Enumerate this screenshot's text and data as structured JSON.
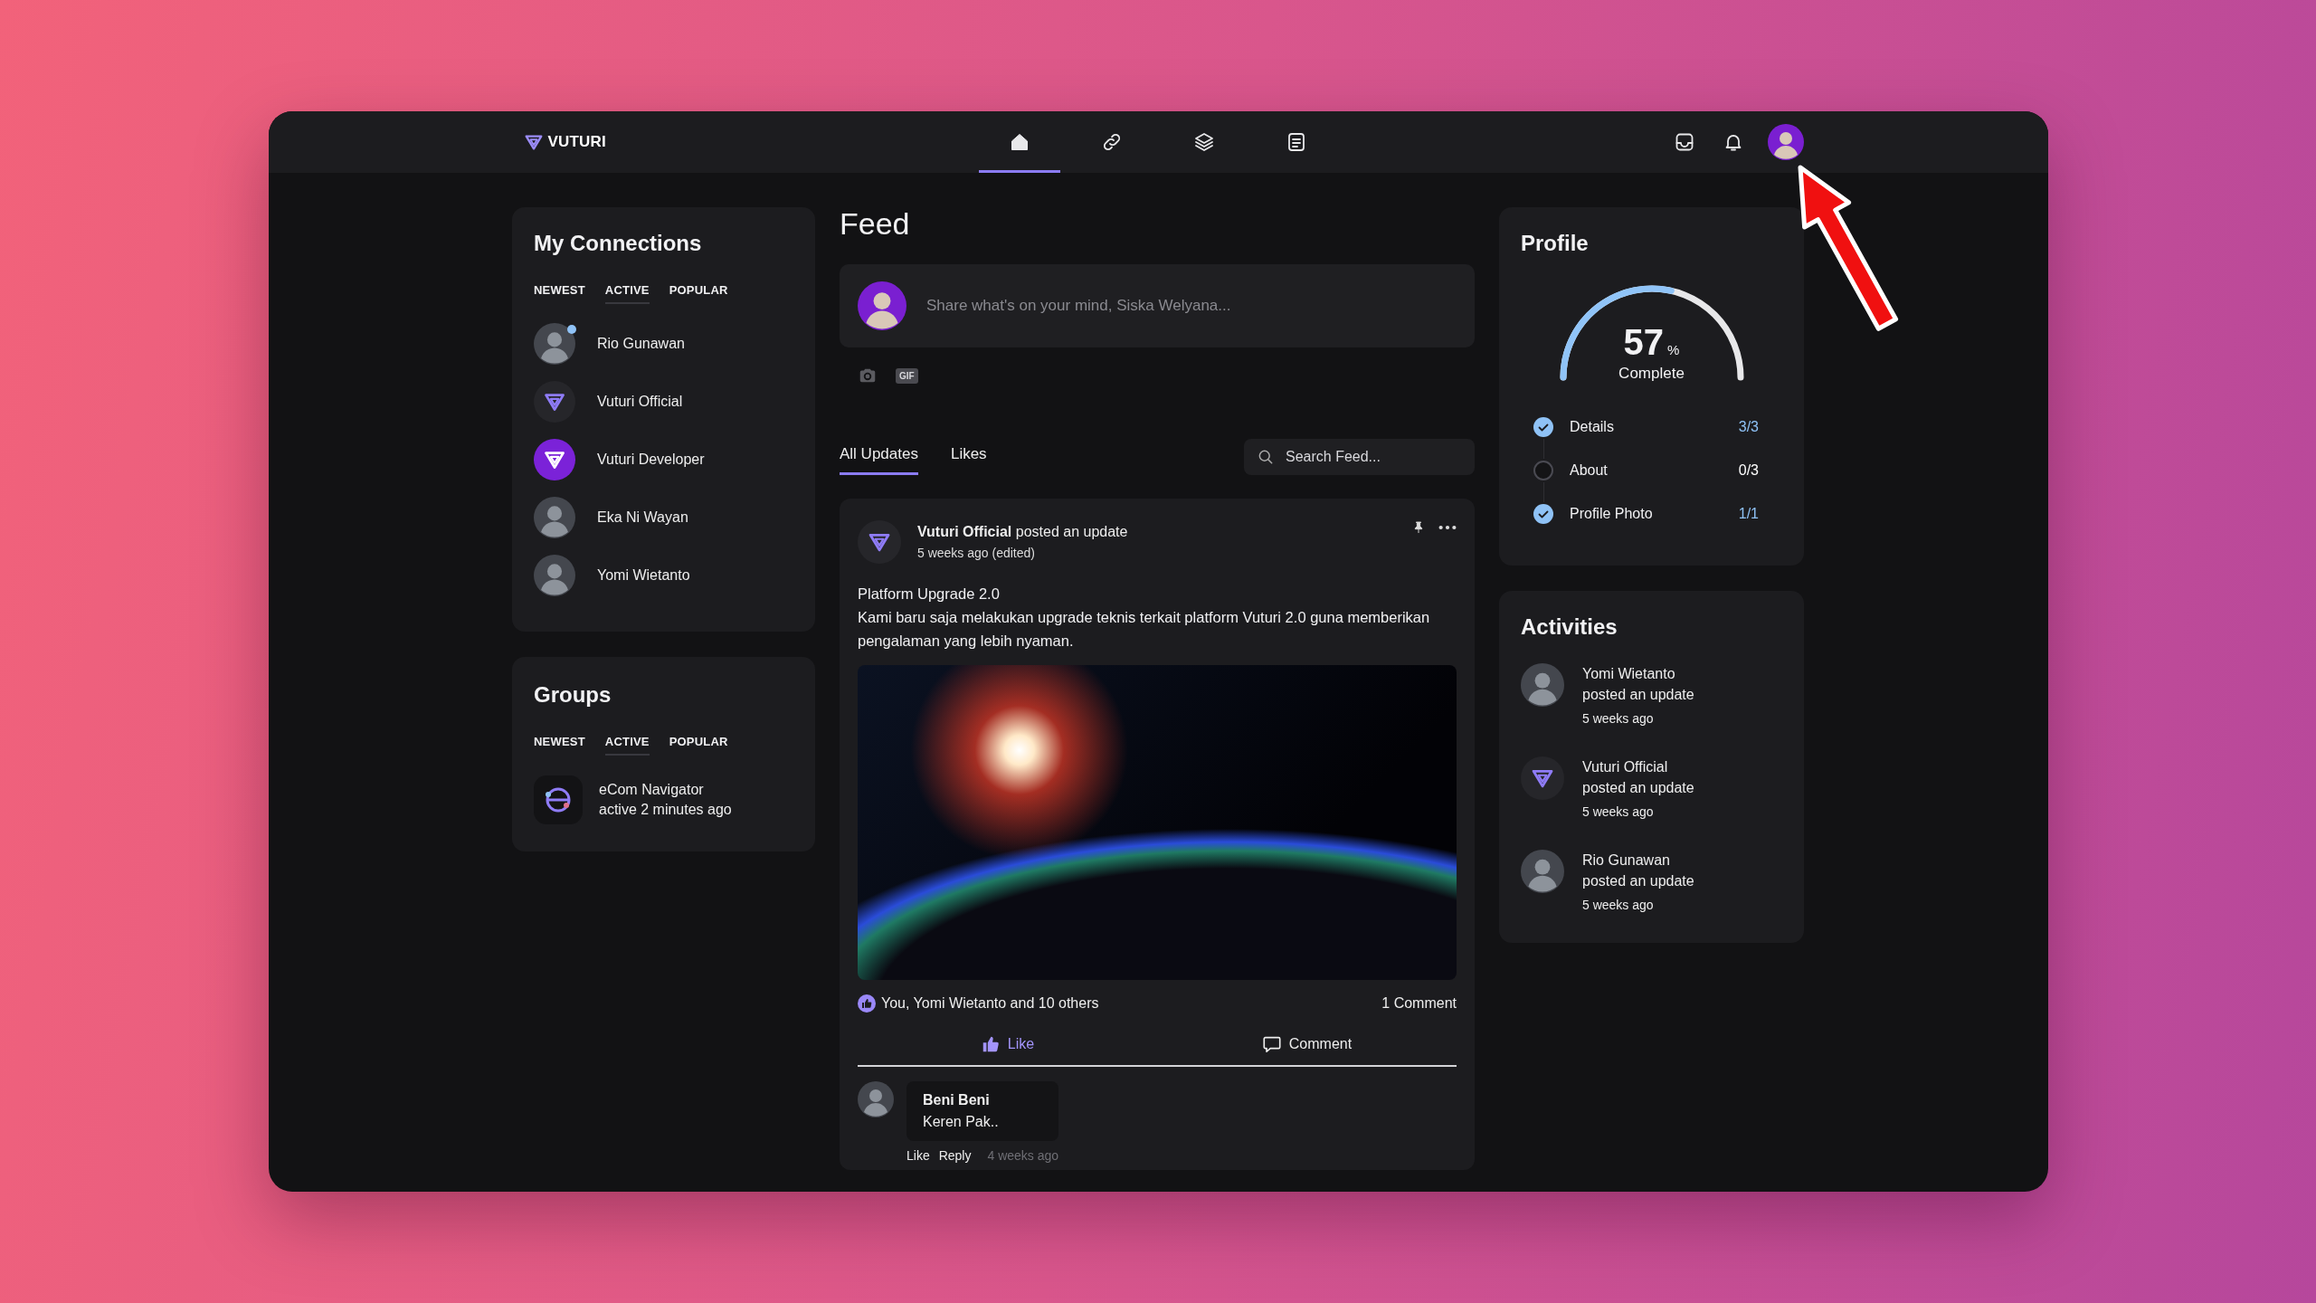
{
  "brand": {
    "name": "VUTURI"
  },
  "nav": [
    {
      "kind": "home",
      "selected": true
    },
    {
      "kind": "link",
      "selected": false
    },
    {
      "kind": "layers",
      "selected": false
    },
    {
      "kind": "document",
      "selected": false
    }
  ],
  "connections": {
    "title": "My Connections",
    "filters": [
      {
        "label": "NEWEST",
        "selected": false
      },
      {
        "label": "ACTIVE",
        "selected": true
      },
      {
        "label": "POPULAR",
        "selected": false
      }
    ],
    "items": [
      {
        "name": "Rio Gunawan",
        "avatar": {
          "kind": "photo"
        },
        "online": true
      },
      {
        "name": "Vuturi Official",
        "avatar": {
          "kind": "logo"
        },
        "online": false
      },
      {
        "name": "Vuturi Developer",
        "avatar": {
          "kind": "logo-filled"
        },
        "online": false
      },
      {
        "name": "Eka Ni Wayan",
        "avatar": {
          "kind": "photo"
        },
        "online": false
      },
      {
        "name": "Yomi Wietanto",
        "avatar": {
          "kind": "photo"
        },
        "online": false
      }
    ]
  },
  "groups": {
    "title": "Groups",
    "filters": [
      {
        "label": "NEWEST",
        "selected": false
      },
      {
        "label": "ACTIVE",
        "selected": true
      },
      {
        "label": "POPULAR",
        "selected": false
      }
    ],
    "items": [
      {
        "name": "eCom Navigator",
        "activity": "active 2 minutes ago"
      }
    ]
  },
  "feed": {
    "title": "Feed",
    "composer": {
      "placeholder": "Share what's on your mind, Siska Welyana...",
      "gif_label": "GIF"
    },
    "tabs": [
      {
        "label": "All Updates",
        "selected": true
      },
      {
        "label": "Likes",
        "selected": false
      }
    ],
    "search": {
      "placeholder": "Search Feed..."
    },
    "post": {
      "header": "**Vuturi Official** posted an update",
      "time": "5 weeks ago (edited)",
      "pinned": true,
      "title": "Platform Upgrade 2.0",
      "body": "Kami baru saja melakukan upgrade teknis terkait platform Vuturi 2.0 guna memberikan pengalaman yang lebih nyaman.",
      "reactions": "You, Yomi Wietanto and 10 others",
      "comment_count": "1 Comment",
      "actions": [
        {
          "kind": "like",
          "label": "Like",
          "active": true
        },
        {
          "kind": "comment",
          "label": "Comment",
          "active": false
        }
      ],
      "comments": [
        {
          "author": "Beni Beni",
          "text": "Keren Pak..",
          "actions": [
            "Like",
            "Reply"
          ],
          "time": "4 weeks ago"
        }
      ]
    }
  },
  "profile": {
    "title": "Profile",
    "percent": "57",
    "percent_sign": "%",
    "level": 0.57,
    "caption": "Complete",
    "steps": [
      {
        "label": "Details",
        "progress": "3/3",
        "done": true
      },
      {
        "label": "About",
        "progress": "0/3",
        "done": false
      },
      {
        "label": "Profile Photo",
        "progress": "1/1",
        "done": true
      }
    ]
  },
  "activities": {
    "title": "Activities",
    "items": [
      {
        "name": "Yomi Wietanto",
        "action": "posted an update",
        "time": "5 weeks ago",
        "avatar": {
          "kind": "photo"
        }
      },
      {
        "name": "Vuturi Official",
        "action": "posted an update",
        "time": "5 weeks ago",
        "avatar": {
          "kind": "logo"
        }
      },
      {
        "name": "Rio Gunawan",
        "action": "posted an update",
        "time": "5 weeks ago",
        "avatar": {
          "kind": "photo"
        }
      }
    ]
  }
}
